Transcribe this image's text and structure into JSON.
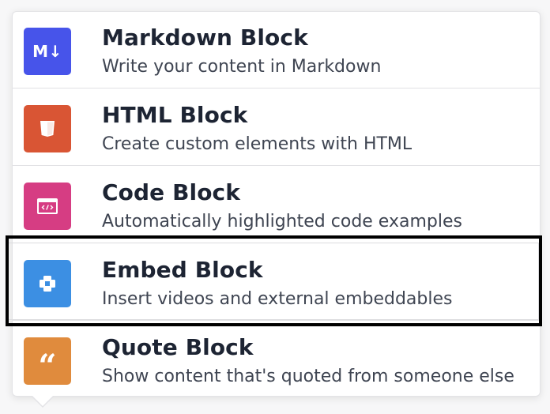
{
  "menu": {
    "items": [
      {
        "title": "Markdown Block",
        "description": "Write your content in Markdown",
        "icon": "markdown-icon",
        "icon_text": "M↓",
        "color": "#4754ea"
      },
      {
        "title": "HTML Block",
        "description": "Create custom elements with HTML",
        "icon": "html5-icon",
        "color": "#d95534"
      },
      {
        "title": "Code Block",
        "description": "Automatically highlighted code examples",
        "icon": "code-window-icon",
        "color": "#d63d83"
      },
      {
        "title": "Embed Block",
        "description": "Insert videos and external embeddables",
        "icon": "embed-icon",
        "color": "#3c8fe3",
        "highlighted": true
      },
      {
        "title": "Quote Block",
        "description": "Show content that's quoted from someone else",
        "icon": "quote-icon",
        "icon_text": "“",
        "color": "#e08b3d"
      }
    ]
  },
  "highlight_color": "#000000"
}
